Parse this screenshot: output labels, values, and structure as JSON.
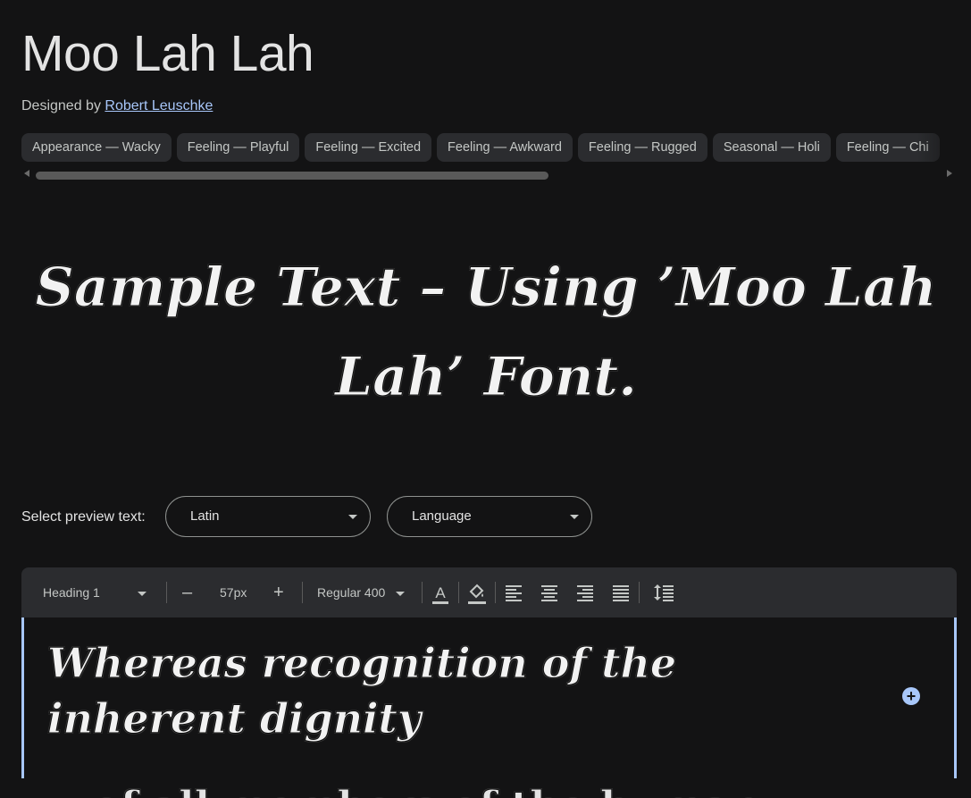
{
  "font": {
    "title": "Moo Lah Lah",
    "designed_by_label": "Designed by",
    "designer": "Robert Leuschke"
  },
  "tags": [
    "Appearance — Wacky",
    "Feeling — Playful",
    "Feeling — Excited",
    "Feeling — Awkward",
    "Feeling — Rugged",
    "Seasonal — Holi",
    "Feeling — Chi"
  ],
  "sample_text": "Sample Text – Using ’Moo Lah Lah’ Font.",
  "preview": {
    "label": "Select preview text:",
    "script_value": "Latin",
    "language_value": "Language"
  },
  "toolbar": {
    "style_value": "Heading 1",
    "decrease_label": "–",
    "size_value": "57px",
    "increase_label": "+",
    "weight_value": "Regular 400",
    "text_color_icon": "text-color-icon",
    "fill_color_icon": "fill-color-icon",
    "align_icons": [
      "align-left-icon",
      "align-center-icon",
      "align-right-icon",
      "align-justify-icon"
    ],
    "line_height_icon": "line-height-icon"
  },
  "editor": {
    "text": "Whereas recognition of the inherent dignity",
    "next_line_partial": "of all members of the human"
  },
  "colors": {
    "background": "#131314",
    "chip": "#2b2c2f",
    "link": "#a8c7fa",
    "accent": "#a8c7fa"
  }
}
